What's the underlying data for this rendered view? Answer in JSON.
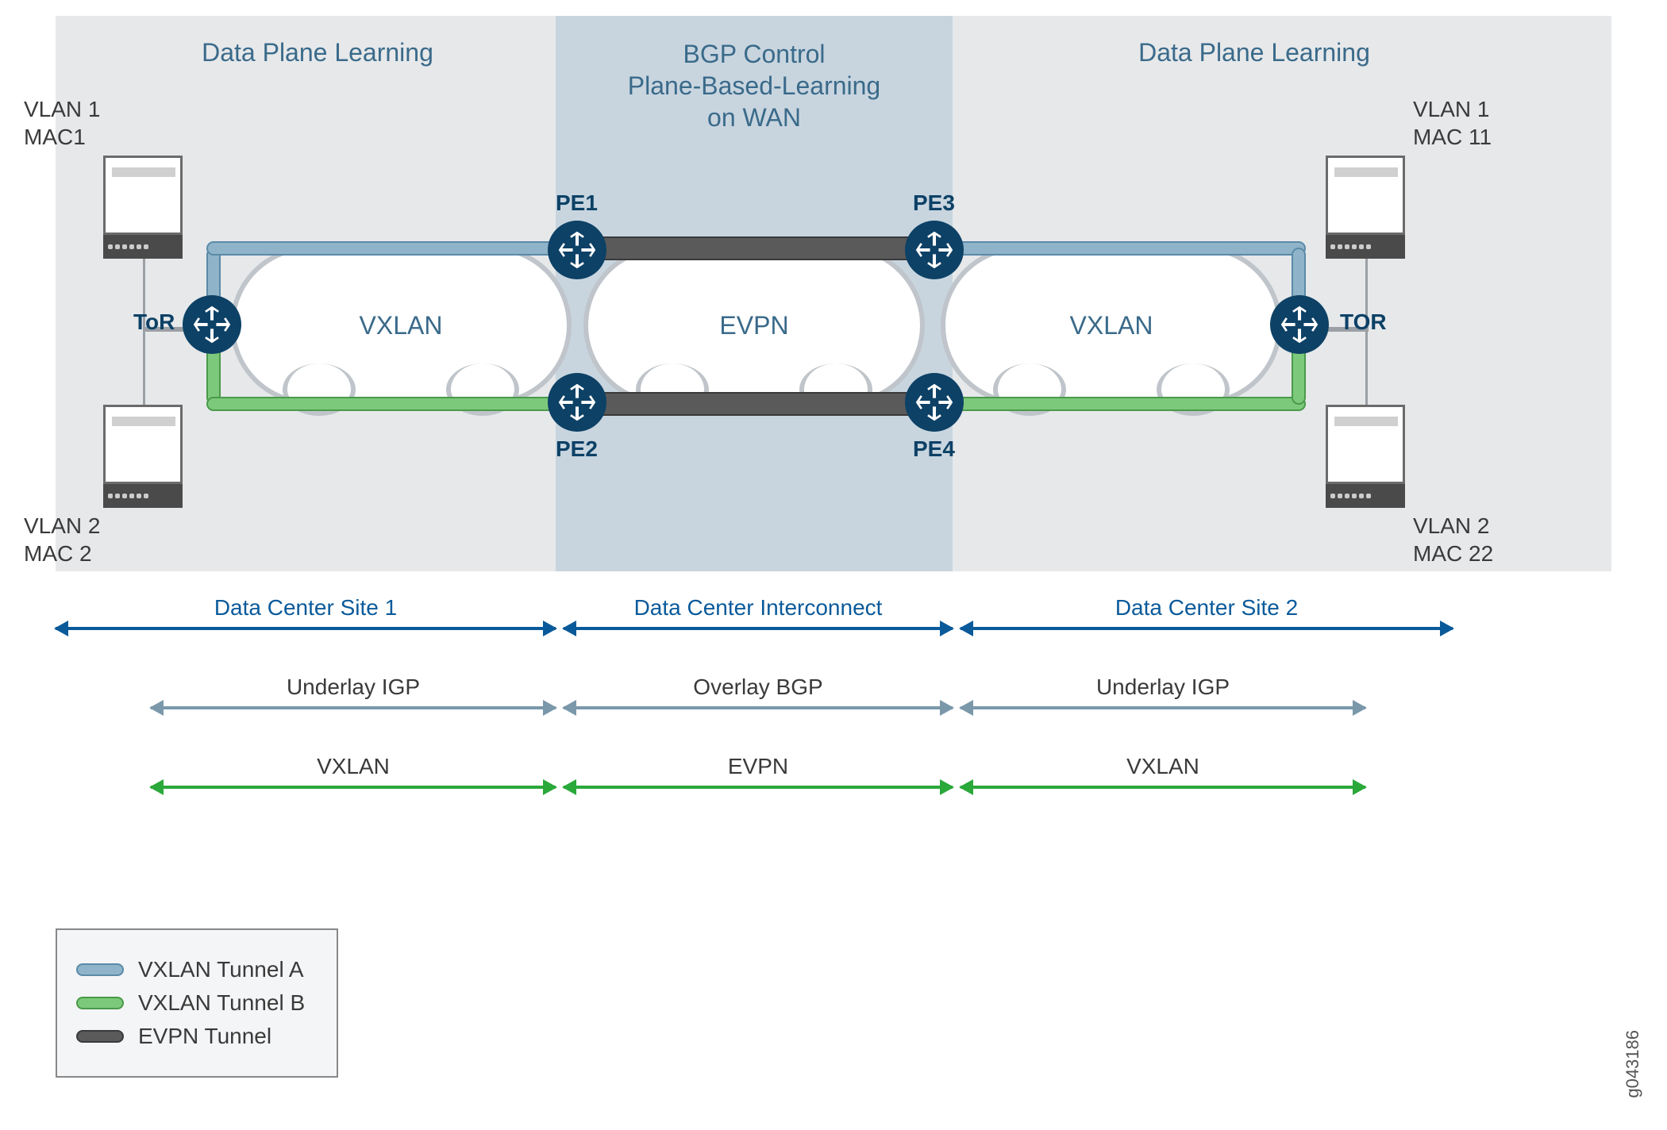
{
  "headings": {
    "left": "Data Plane Learning",
    "center_l1": "BGP Control",
    "center_l2": "Plane-Based-Learning",
    "center_l3": "on WAN",
    "right": "Data Plane Learning"
  },
  "clouds": {
    "left": "VXLAN",
    "center": "EVPN",
    "right": "VXLAN"
  },
  "routers": {
    "tor_left": "ToR",
    "tor_right": "TOR",
    "pe1": "PE1",
    "pe2": "PE2",
    "pe3": "PE3",
    "pe4": "PE4"
  },
  "servers": {
    "top_left_l1": "VLAN 1",
    "top_left_l2": "MAC1",
    "bot_left_l1": "VLAN 2",
    "bot_left_l2": "MAC 2",
    "top_right_l1": "VLAN 1",
    "top_right_l2": "MAC 11",
    "bot_right_l1": "VLAN 2",
    "bot_right_l2": "MAC 22"
  },
  "arrows": {
    "row1": {
      "a": "Data Center Site 1",
      "b": "Data Center Interconnect",
      "c": "Data Center Site 2"
    },
    "row2": {
      "a": "Underlay IGP",
      "b": "Overlay BGP",
      "c": "Underlay IGP"
    },
    "row3": {
      "a": "VXLAN",
      "b": "EVPN",
      "c": "VXLAN"
    }
  },
  "legend": {
    "a": "VXLAN Tunnel A",
    "b": "VXLAN Tunnel B",
    "c": "EVPN Tunnel"
  },
  "image_id": "g043186",
  "colors": {
    "tunnel_blue": "#8fb4c9",
    "tunnel_green": "#7cc97c",
    "tunnel_grey": "#5a5a5a",
    "router_fill": "#0d4166"
  }
}
